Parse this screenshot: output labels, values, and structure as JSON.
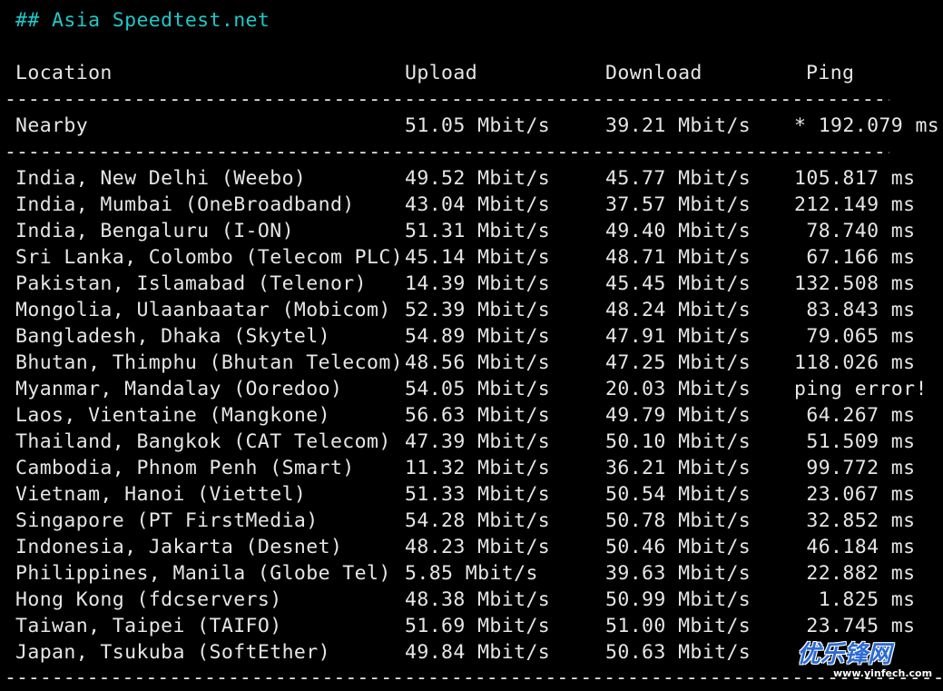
{
  "title": "## Asia Speedtest.net",
  "headers": {
    "location": "Location",
    "upload": "Upload",
    "download": "Download",
    "ping": "Ping"
  },
  "rule": "--------------------------------------------------------------------------------------",
  "nearby": {
    "location": "Nearby",
    "upload": "51.05 Mbit/s",
    "download": "39.21 Mbit/s",
    "ping": "* 192.079 ms"
  },
  "rows": [
    {
      "location": "India, New Delhi (Weebo)",
      "upload": "49.52 Mbit/s",
      "download": "45.77 Mbit/s",
      "ping": "105.817 ms"
    },
    {
      "location": "India, Mumbai (OneBroadband)",
      "upload": "43.04 Mbit/s",
      "download": "37.57 Mbit/s",
      "ping": "212.149 ms"
    },
    {
      "location": "India, Bengaluru (I-ON)",
      "upload": "51.31 Mbit/s",
      "download": "49.40 Mbit/s",
      "ping": " 78.740 ms"
    },
    {
      "location": "Sri Lanka, Colombo (Telecom PLC)",
      "upload": "45.14 Mbit/s",
      "download": "48.71 Mbit/s",
      "ping": " 67.166 ms"
    },
    {
      "location": "Pakistan, Islamabad (Telenor)",
      "upload": "14.39 Mbit/s",
      "download": "45.45 Mbit/s",
      "ping": "132.508 ms"
    },
    {
      "location": "Mongolia, Ulaanbaatar (Mobicom)",
      "upload": "52.39 Mbit/s",
      "download": "48.24 Mbit/s",
      "ping": " 83.843 ms"
    },
    {
      "location": "Bangladesh, Dhaka (Skytel)",
      "upload": "54.89 Mbit/s",
      "download": "47.91 Mbit/s",
      "ping": " 79.065 ms"
    },
    {
      "location": "Bhutan, Thimphu (Bhutan Telecom)",
      "upload": "48.56 Mbit/s",
      "download": "47.25 Mbit/s",
      "ping": "118.026 ms"
    },
    {
      "location": "Myanmar, Mandalay (Ooredoo)",
      "upload": "54.05 Mbit/s",
      "download": "20.03 Mbit/s",
      "ping": "ping error!"
    },
    {
      "location": "Laos, Vientaine (Mangkone)",
      "upload": "56.63 Mbit/s",
      "download": "49.79 Mbit/s",
      "ping": " 64.267 ms"
    },
    {
      "location": "Thailand, Bangkok (CAT Telecom)",
      "upload": "47.39 Mbit/s",
      "download": "50.10 Mbit/s",
      "ping": " 51.509 ms"
    },
    {
      "location": "Cambodia, Phnom Penh (Smart)",
      "upload": "11.32 Mbit/s",
      "download": "36.21 Mbit/s",
      "ping": " 99.772 ms"
    },
    {
      "location": "Vietnam, Hanoi (Viettel)",
      "upload": "51.33 Mbit/s",
      "download": "50.54 Mbit/s",
      "ping": " 23.067 ms"
    },
    {
      "location": "Singapore (PT FirstMedia)",
      "upload": "54.28 Mbit/s",
      "download": "50.78 Mbit/s",
      "ping": " 32.852 ms"
    },
    {
      "location": "Indonesia, Jakarta (Desnet)",
      "upload": "48.23 Mbit/s",
      "download": "50.46 Mbit/s",
      "ping": " 46.184 ms"
    },
    {
      "location": "Philippines, Manila (Globe Tel)",
      "upload": "5.85 Mbit/s",
      "download": "39.63 Mbit/s",
      "ping": " 22.882 ms"
    },
    {
      "location": "Hong Kong (fdcservers)",
      "upload": "48.38 Mbit/s",
      "download": "50.99 Mbit/s",
      "ping": "  1.825 ms"
    },
    {
      "location": "Taiwan, Taipei (TAIFO)",
      "upload": "51.69 Mbit/s",
      "download": "51.00 Mbit/s",
      "ping": " 23.745 ms"
    },
    {
      "location": "Japan, Tsukuba (SoftEther)",
      "upload": "49.84 Mbit/s",
      "download": "50.63 Mbit/s",
      "ping": ""
    }
  ],
  "watermark": {
    "text": "优乐锋网",
    "sub": "www.yinfech.com"
  },
  "colors": {
    "background": "#000000",
    "text": "#e6e6e6",
    "title": "#1ec8c8"
  }
}
